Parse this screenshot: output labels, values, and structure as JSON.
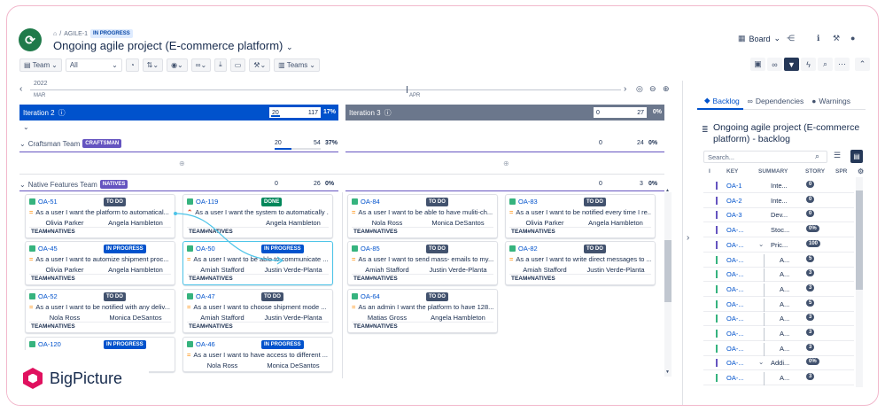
{
  "header": {
    "breadcrumb_project": "AGILE-1",
    "breadcrumb_status": "IN PROGRESS",
    "title": "Ongoing agile project (E-commerce platform)",
    "board_label": "Board"
  },
  "toolbar": {
    "team_label": "Team",
    "filter_value": "All",
    "teams_label": "Teams"
  },
  "timeline": {
    "year": "2022",
    "month_start": "MAR",
    "month_mid": "APR"
  },
  "iterations": [
    {
      "name": "Iteration 2",
      "start": "20",
      "total": "117",
      "pct": "17%"
    },
    {
      "name": "Iteration 3",
      "start": "0",
      "total": "27",
      "pct": "0%"
    }
  ],
  "teams": [
    {
      "name": "Craftsman Team",
      "badge": "CRAFTSMAN",
      "i2_start": "20",
      "i2_total": "54",
      "i2_pct": "37%",
      "i3_start": "0",
      "i3_total": "24",
      "i3_pct": "0%"
    },
    {
      "name": "Native Features Team",
      "badge": "NATIVES",
      "i2_start": "0",
      "i2_total": "26",
      "i2_pct": "0%",
      "i3_start": "0",
      "i3_total": "3",
      "i3_pct": "0%"
    }
  ],
  "cards": [
    {
      "key": "OA-51",
      "status": "TO DO",
      "summary": "As a user I want the platform to automatical...",
      "p1": "Olivia Parker",
      "p2": "Angela Hambleton",
      "team": "TEAM#NATIVES"
    },
    {
      "key": "OA-119",
      "status": "DONE",
      "summary": "As a user I want the system to automatically ...",
      "p1": "",
      "p2": "Angela Hambleton",
      "team": "TEAM#NATIVES"
    },
    {
      "key": "OA-84",
      "status": "TO DO",
      "summary": "As a user I want to be able to have muliti-ch...",
      "p1": "Nola Ross",
      "p2": "Monica DeSantos",
      "team": "TEAM#NATIVES"
    },
    {
      "key": "OA-83",
      "status": "TO DO",
      "summary": "As a user I want to be notified every time I re...",
      "p1": "Olivia Parker",
      "p2": "Angela Hambleton",
      "team": "TEAM#NATIVES"
    },
    {
      "key": "OA-45",
      "status": "IN PROGRESS",
      "summary": "As a user I want to automize shipment proc...",
      "p1": "Olivia Parker",
      "p2": "Angela Hambleton",
      "team": "TEAM#NATIVES"
    },
    {
      "key": "OA-50",
      "status": "IN PROGRESS",
      "summary": "As a user I want to be able to communicate ...",
      "p1": "Amiah Stafford",
      "p2": "Justin Verde-Planta",
      "team": "TEAM#NATIVES"
    },
    {
      "key": "OA-85",
      "status": "TO DO",
      "summary": "As a user I want to send mass- emails to my...",
      "p1": "Amiah Stafford",
      "p2": "Justin Verde-Planta",
      "team": "TEAM#NATIVES"
    },
    {
      "key": "OA-82",
      "status": "TO DO",
      "summary": "As a user I want to write direct messages to ...",
      "p1": "Amiah Stafford",
      "p2": "Justin Verde-Planta",
      "team": "TEAM#NATIVES"
    },
    {
      "key": "OA-52",
      "status": "TO DO",
      "summary": "As a user I want to be notified with any deliv...",
      "p1": "Nola Ross",
      "p2": "Monica DeSantos",
      "team": "TEAM#NATIVES"
    },
    {
      "key": "OA-47",
      "status": "TO DO",
      "summary": "As a user I want to choose shipment mode ...",
      "p1": "Amiah Stafford",
      "p2": "Justin Verde-Planta",
      "team": "TEAM#NATIVES"
    },
    {
      "key": "OA-64",
      "status": "TO DO",
      "summary": "As an admin I want the platform to have 128...",
      "p1": "Matias Gross",
      "p2": "Angela Hambleton",
      "team": "TEAM#NATIVES"
    },
    {
      "key": "OA-120",
      "status": "IN PROGRESS",
      "summary": "As a user I want to change si...",
      "p1": "",
      "p2": "",
      "team": ""
    },
    {
      "key": "OA-46",
      "status": "IN PROGRESS",
      "summary": "As a user I want to have access to different ...",
      "p1": "Nola Ross",
      "p2": "Monica DeSantos",
      "team": ""
    }
  ],
  "sidepanel": {
    "tab_backlog": "Backlog",
    "tab_dependencies": "Dependencies",
    "tab_warnings": "Warnings",
    "title": "Ongoing agile project (E-commerce platform) - backlog",
    "search_placeholder": "Search...",
    "col_i": "I",
    "col_key": "KEY",
    "col_summary": "SUMMARY",
    "col_story": "STORY",
    "col_spr": "SPR",
    "rows": [
      {
        "key": "OA-1",
        "summary": "Inte...",
        "sp": "0",
        "color": "#6554c0"
      },
      {
        "key": "OA-2",
        "summary": "Inte...",
        "sp": "0",
        "color": "#6554c0"
      },
      {
        "key": "OA-3",
        "summary": "Dev...",
        "sp": "0",
        "color": "#6554c0"
      },
      {
        "key": "OA-...",
        "summary": "Stoc...",
        "sp": "0%",
        "color": "#6554c0"
      },
      {
        "key": "OA-...",
        "summary": "Pric...",
        "sp": "100",
        "color": "#6554c0"
      },
      {
        "key": "OA-...",
        "summary": "A...",
        "sp": "5",
        "color": "#36b37e"
      },
      {
        "key": "OA-...",
        "summary": "A...",
        "sp": "3",
        "color": "#36b37e"
      },
      {
        "key": "OA-...",
        "summary": "A...",
        "sp": "3",
        "color": "#36b37e"
      },
      {
        "key": "OA-...",
        "summary": "A...",
        "sp": "5",
        "color": "#36b37e"
      },
      {
        "key": "OA-...",
        "summary": "A...",
        "sp": "3",
        "color": "#36b37e"
      },
      {
        "key": "OA-...",
        "summary": "A...",
        "sp": "3",
        "color": "#36b37e"
      },
      {
        "key": "OA-...",
        "summary": "A...",
        "sp": "3",
        "color": "#36b37e"
      },
      {
        "key": "OA-...",
        "summary": "Addi...",
        "sp": "0%",
        "color": "#6554c0"
      },
      {
        "key": "OA-...",
        "summary": "A...",
        "sp": "3",
        "color": "#36b37e"
      }
    ]
  },
  "brand": {
    "name": "BigPicture",
    "accent": "#e0115f"
  },
  "colors": {
    "iteration_active": "#0052cc",
    "iteration_inactive": "#6b778c",
    "team_accent": "#6554c0"
  }
}
